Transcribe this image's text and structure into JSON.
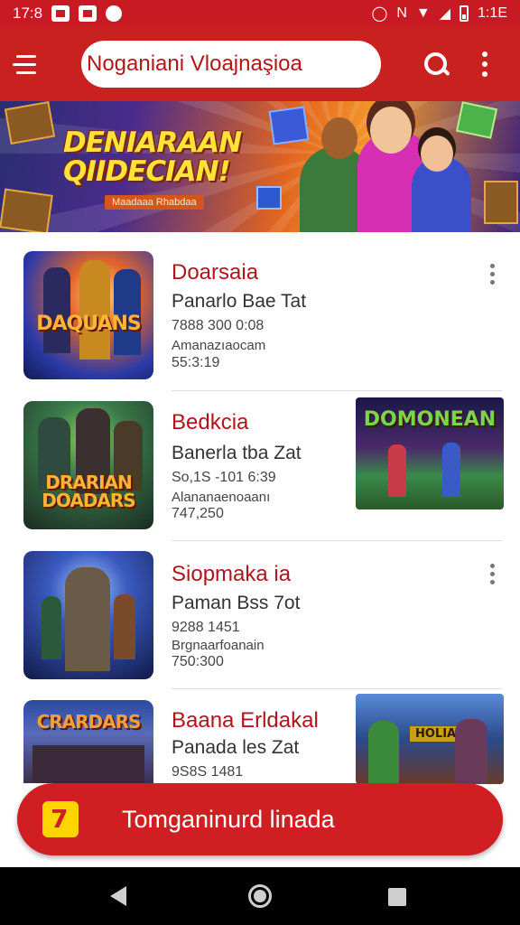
{
  "status_bar": {
    "time": "17:8",
    "right_text": "1:1E"
  },
  "search": {
    "query": "Noganiani Vloajnaşioa"
  },
  "banner": {
    "title_line1": "DENIARAAN",
    "title_line2": "QIIDECIAN!",
    "tag": "Maadaaa Rhabdaa"
  },
  "items": [
    {
      "title": "Doarsaia",
      "subtitle": "Panarlo Bae Tat",
      "line1": "7888 300 0:08",
      "line2": "Amanazıaocam",
      "line3": "55:3:19",
      "thumb_text": "DAQUANS"
    },
    {
      "title": "Bedkcia",
      "subtitle": "Banerla tba Zat",
      "line1": "So,1S -101 6:39",
      "line2": "Alananaenoaanı",
      "line3": "747,250",
      "thumb_text": "DRARIAN DOADARS",
      "side_text": "DOMONEAN"
    },
    {
      "title": "Siopmaka ia",
      "subtitle": "Paman Bss 7ot",
      "line1": "9288 1451",
      "line2": "Brgnaarfoanain",
      "line3": "750:300",
      "thumb_text": ""
    },
    {
      "title": "Baana Erldakal",
      "subtitle": "Panada les Zat",
      "line1": "9S8S 1481",
      "thumb_text": "CRARDARS",
      "side_text": "HOLIAAN"
    }
  ],
  "cta": {
    "label": "Tomganinurd linada"
  },
  "colors": {
    "brand_red": "#c8211f",
    "title_red": "#b0151b",
    "accent_yellow": "#ffd500"
  }
}
